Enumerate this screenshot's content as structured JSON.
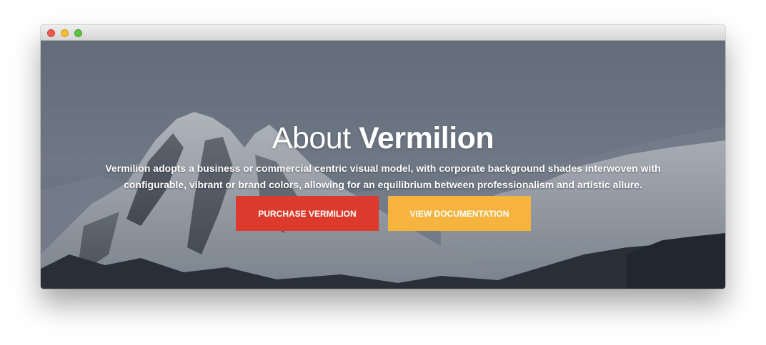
{
  "window": {
    "controls": [
      "close",
      "minimize",
      "maximize"
    ]
  },
  "hero": {
    "title_light": "About",
    "title_bold": "Vermilion",
    "description": "Vermilion adopts a business or commercial centric visual model, with corporate background shades interwoven with configurable, vibrant or brand colors, allowing for an equilibrium between professionalism and artistic allure.",
    "buttons": {
      "purchase": "PURCHASE VERMILION",
      "docs": "VIEW DOCUMENTATION"
    }
  },
  "colors": {
    "purchase_button": "#dc3a2c",
    "docs_button": "#f6b43f"
  }
}
